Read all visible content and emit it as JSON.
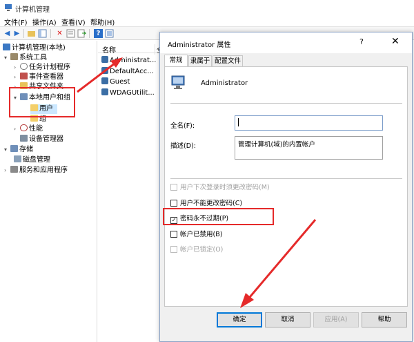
{
  "window": {
    "title": "计算机管理"
  },
  "menu": [
    "文件(F)",
    "操作(A)",
    "查看(V)",
    "帮助(H)"
  ],
  "tree": [
    {
      "label": "计算机管理(本地)",
      "icon": "computer-icon",
      "arrow": ""
    },
    {
      "label": "系统工具",
      "icon": "tools-icon",
      "arrow": "▾"
    },
    {
      "label": "任务计划程序",
      "icon": "clock-icon",
      "arrow": "›"
    },
    {
      "label": "事件查看器",
      "icon": "event-icon",
      "arrow": "›"
    },
    {
      "label": "共享文件夹",
      "icon": "share-icon",
      "arrow": "›"
    },
    {
      "label": "本地用户和组",
      "icon": "users-icon",
      "arrow": "▾"
    },
    {
      "label": "用户",
      "icon": "folder-icon",
      "arrow": ""
    },
    {
      "label": "组",
      "icon": "folder-icon",
      "arrow": ""
    },
    {
      "label": "性能",
      "icon": "perf-icon",
      "arrow": "›"
    },
    {
      "label": "设备管理器",
      "icon": "device-icon",
      "arrow": ""
    },
    {
      "label": "存储",
      "icon": "storage-icon",
      "arrow": "▾"
    },
    {
      "label": "磁盘管理",
      "icon": "disk-icon",
      "arrow": ""
    },
    {
      "label": "服务和应用程序",
      "icon": "services-icon",
      "arrow": "›"
    }
  ],
  "list": {
    "header": "名称",
    "header2": "全",
    "rows": [
      "Administrat...",
      "DefaultAcc...",
      "Guest",
      "WDAGUtilit..."
    ]
  },
  "dialog": {
    "title": "Administrator 属性",
    "help": "?",
    "close": "✕",
    "tabs": [
      "常规",
      "隶属于",
      "配置文件"
    ],
    "user_name": "Administrator",
    "fullname_label": "全名(F):",
    "fullname_value": "",
    "desc_label": "描述(D):",
    "desc_value": "管理计算机(域)的内置帐户",
    "checkboxes": [
      {
        "label": "用户下次登录时须更改密码(M)",
        "checked": false,
        "disabled": true
      },
      {
        "label": "用户不能更改密码(C)",
        "checked": false,
        "disabled": false
      },
      {
        "label": "密码永不过期(P)",
        "checked": true,
        "disabled": false
      },
      {
        "label": "帐户已禁用(B)",
        "checked": false,
        "disabled": false
      },
      {
        "label": "帐户已锁定(O)",
        "checked": false,
        "disabled": true
      }
    ],
    "buttons": [
      "确定",
      "取消",
      "应用(A)",
      "帮助"
    ]
  },
  "colors": {
    "annotation": "#e52a2a",
    "accent": "#0078d7"
  }
}
